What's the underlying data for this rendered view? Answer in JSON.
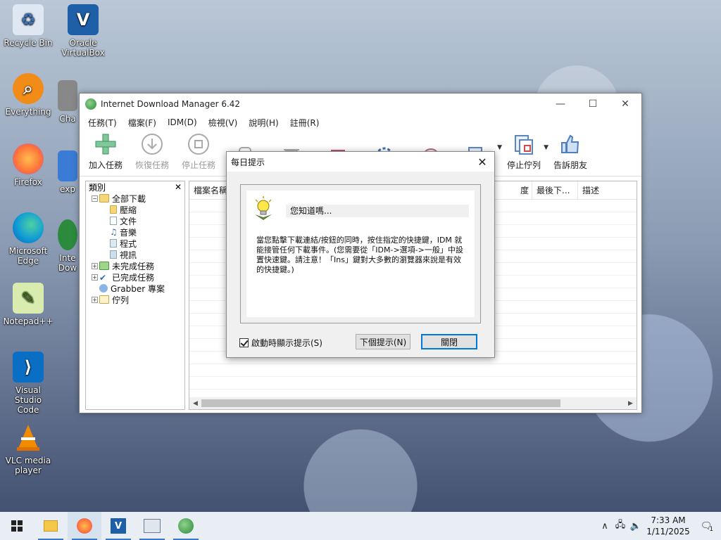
{
  "desktop": {
    "icons": [
      {
        "label": "Recycle Bin",
        "icon": "recycle-bin-icon",
        "color": "#5a8fc8"
      },
      {
        "label": "Oracle VirtualBox",
        "icon": "virtualbox-icon",
        "color": "#1f5fa8"
      },
      {
        "label": "Everything",
        "icon": "everything-search-icon",
        "color": "#f28c18"
      },
      {
        "label": "Cha",
        "icon": "app-icon",
        "color": "#777777"
      },
      {
        "label": "Firefox",
        "icon": "firefox-icon",
        "color": "#ff7139"
      },
      {
        "label": "exp",
        "icon": "app-icon",
        "color": "#3a7bd5"
      },
      {
        "label": "Microsoft Edge",
        "icon": "edge-icon",
        "color": "#0f9bd7"
      },
      {
        "label": "Inte Dow",
        "icon": "idm-icon",
        "color": "#2b8a3e"
      },
      {
        "label": "Notepad++",
        "icon": "notepadpp-icon",
        "color": "#8bc34a"
      },
      {
        "label": "Visual Studio Code",
        "icon": "vscode-icon",
        "color": "#0a6fc4"
      },
      {
        "label": "VLC media player",
        "icon": "vlc-icon",
        "color": "#f08a00"
      }
    ]
  },
  "idm": {
    "title": "Internet Download Manager 6.42",
    "menu": [
      "任務(T)",
      "檔案(F)",
      "IDM(D)",
      "檢視(V)",
      "說明(H)",
      "註冊(R)"
    ],
    "toolbar": {
      "add": "加入任務",
      "resume": "恢復任務",
      "stop": "停止任務",
      "stop_queue": "停止佇列",
      "tell_friend": "告訴朋友"
    },
    "sidebar": {
      "title": "類別",
      "close": "✕",
      "items": [
        {
          "label": "全部下載",
          "level": 0,
          "expander": "−"
        },
        {
          "label": "壓縮",
          "level": 1
        },
        {
          "label": "文件",
          "level": 1
        },
        {
          "label": "音樂",
          "level": 1
        },
        {
          "label": "程式",
          "level": 1
        },
        {
          "label": "視訊",
          "level": 1
        },
        {
          "label": "未完成任務",
          "level": 0,
          "expander": "+"
        },
        {
          "label": "已完成任務",
          "level": 0,
          "expander": "+"
        },
        {
          "label": "Grabber 專案",
          "level": 0
        },
        {
          "label": "佇列",
          "level": 0,
          "expander": "+"
        }
      ]
    },
    "columns": {
      "name": "檔案名稱",
      "date_suffix": "度",
      "last": "最後下...",
      "desc": "描述"
    }
  },
  "dialog": {
    "title": "每日提示",
    "close": "✕",
    "heading": "您知道嗎...",
    "body": "當您點擊下載連結/按鈕的同時，按住指定的快捷鍵，IDM 就能接管任何下載事件。(您需要從「IDM->選項->一般」中設置快速鍵。請注意！「Ins」鍵對大多數的瀏覽器來說是有效的快捷鍵。)",
    "checkbox_label": "啟動時顯示提示(S)",
    "next_button": "下個提示(N)",
    "close_button": "關閉"
  },
  "taskbar": {
    "time": "7:33 AM",
    "date": "1/11/2025",
    "notification_count": "1"
  }
}
